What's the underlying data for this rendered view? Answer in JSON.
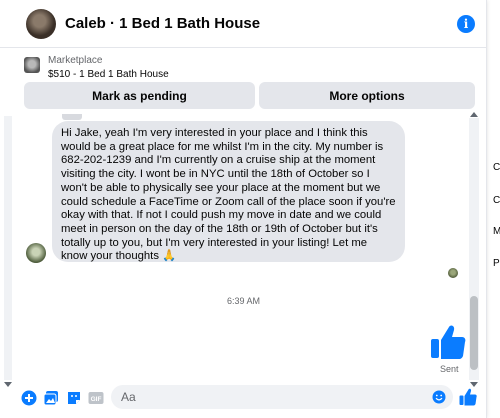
{
  "header": {
    "title": "Caleb · 1 Bed 1 Bath House",
    "info_icon": "info-icon"
  },
  "marketplace": {
    "label": "Marketplace",
    "item": "$510 - 1 Bed 1 Bath House",
    "actions": {
      "pending": "Mark as pending",
      "more": "More options"
    }
  },
  "messages": {
    "received": "Hi Jake, yeah I'm very interested in your place and I think this would be a great place for me whilst I'm in the city. My number is 682-202-1239 and I'm currently on a cruise ship at the moment visiting the city. I wont be in NYC until the 18th of October so I won't be able to physically see your place at the moment but we could schedule a FaceTime or Zoom call of the place soon if you're okay with that. If not I could push my move in date and we could meet in person on the day of the 18th or 19th of October but it's totally up to you, but I'm very interested in your listing!  Let me know your thoughts 🙏",
    "timestamp": "6:39 AM",
    "sent_status": "Sent"
  },
  "composer": {
    "placeholder": "Aa",
    "gif_label": "GIF"
  },
  "side_letters": [
    "C",
    "C",
    "M",
    "P"
  ],
  "colors": {
    "accent": "#0a7cff",
    "bubble": "#e4e6eb",
    "button": "#e4e6eb"
  }
}
